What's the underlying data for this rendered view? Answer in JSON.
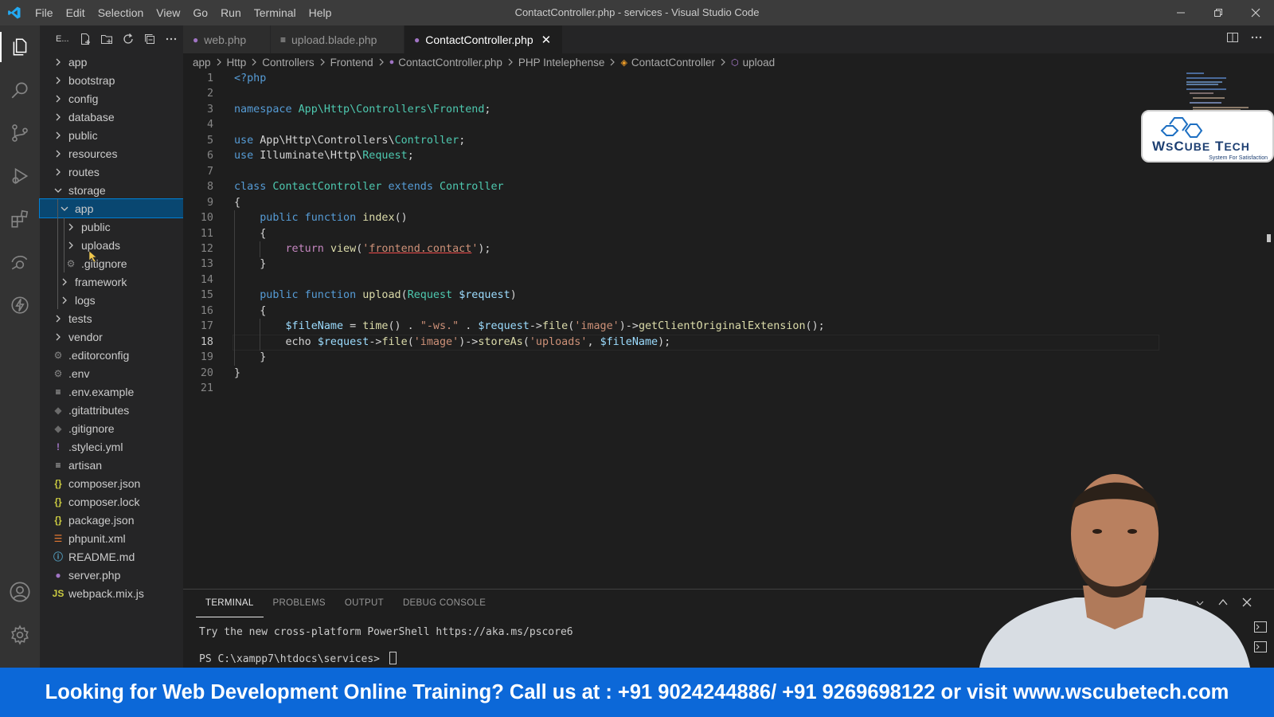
{
  "window": {
    "title": "ContactController.php - services - Visual Studio Code",
    "menu": [
      "File",
      "Edit",
      "Selection",
      "View",
      "Go",
      "Run",
      "Terminal",
      "Help"
    ]
  },
  "sidebar": {
    "title": "E...",
    "tree": [
      {
        "label": "app",
        "type": "folder",
        "expanded": false,
        "depth": 0
      },
      {
        "label": "bootstrap",
        "type": "folder",
        "expanded": false,
        "depth": 0
      },
      {
        "label": "config",
        "type": "folder",
        "expanded": false,
        "depth": 0
      },
      {
        "label": "database",
        "type": "folder",
        "expanded": false,
        "depth": 0
      },
      {
        "label": "public",
        "type": "folder",
        "expanded": false,
        "depth": 0
      },
      {
        "label": "resources",
        "type": "folder",
        "expanded": false,
        "depth": 0
      },
      {
        "label": "routes",
        "type": "folder",
        "expanded": false,
        "depth": 0
      },
      {
        "label": "storage",
        "type": "folder",
        "expanded": true,
        "depth": 0
      },
      {
        "label": "app",
        "type": "folder",
        "expanded": true,
        "depth": 1,
        "selected": true
      },
      {
        "label": "public",
        "type": "folder",
        "expanded": false,
        "depth": 2
      },
      {
        "label": "uploads",
        "type": "folder",
        "expanded": false,
        "depth": 2
      },
      {
        "label": ".gitignore",
        "type": "file",
        "icon": "gear-icon",
        "depth": 2
      },
      {
        "label": "framework",
        "type": "folder",
        "expanded": false,
        "depth": 1
      },
      {
        "label": "logs",
        "type": "folder",
        "expanded": false,
        "depth": 1
      },
      {
        "label": "tests",
        "type": "folder",
        "expanded": false,
        "depth": 0
      },
      {
        "label": "vendor",
        "type": "folder",
        "expanded": false,
        "depth": 0
      },
      {
        "label": ".editorconfig",
        "type": "file",
        "icon": "gear-icon",
        "depth": 0
      },
      {
        "label": ".env",
        "type": "file",
        "icon": "gear-icon",
        "depth": 0
      },
      {
        "label": ".env.example",
        "type": "file",
        "icon": "lines-icon",
        "depth": 0
      },
      {
        "label": ".gitattributes",
        "type": "file",
        "icon": "git-icon",
        "depth": 0
      },
      {
        "label": ".gitignore",
        "type": "file",
        "icon": "git-icon",
        "depth": 0
      },
      {
        "label": ".styleci.yml",
        "type": "file",
        "icon": "yaml-icon",
        "depth": 0
      },
      {
        "label": "artisan",
        "type": "file",
        "icon": "lines-icon",
        "depth": 0
      },
      {
        "label": "composer.json",
        "type": "file",
        "icon": "json-icon",
        "depth": 0
      },
      {
        "label": "composer.lock",
        "type": "file",
        "icon": "json-icon",
        "depth": 0
      },
      {
        "label": "package.json",
        "type": "file",
        "icon": "json-icon",
        "depth": 0
      },
      {
        "label": "phpunit.xml",
        "type": "file",
        "icon": "rss-icon",
        "depth": 0
      },
      {
        "label": "README.md",
        "type": "file",
        "icon": "info-icon",
        "depth": 0
      },
      {
        "label": "server.php",
        "type": "file",
        "icon": "php-icon",
        "depth": 0
      },
      {
        "label": "webpack.mix.js",
        "type": "file",
        "icon": "js-icon",
        "depth": 0
      }
    ]
  },
  "tabs": [
    {
      "label": "web.php",
      "icon": "php-icon",
      "active": false
    },
    {
      "label": "upload.blade.php",
      "icon": "lines-icon",
      "active": false
    },
    {
      "label": "ContactController.php",
      "icon": "php-icon",
      "active": true
    }
  ],
  "breadcrumb": [
    "app",
    "Http",
    "Controllers",
    "Frontend",
    "ContactController.php",
    "PHP Intelephense",
    "ContactController",
    "upload"
  ],
  "editor": {
    "current_line": 18,
    "lines": [
      {
        "n": "1",
        "tokens": [
          [
            "kw",
            "<?php"
          ]
        ]
      },
      {
        "n": "2",
        "tokens": []
      },
      {
        "n": "3",
        "tokens": [
          [
            "kw",
            "namespace "
          ],
          [
            "cls",
            "App\\Http\\Controllers\\Frontend"
          ],
          [
            "txt",
            ";"
          ]
        ]
      },
      {
        "n": "4",
        "tokens": []
      },
      {
        "n": "5",
        "tokens": [
          [
            "kw",
            "use "
          ],
          [
            "txt",
            "App\\Http\\Controllers\\"
          ],
          [
            "cls",
            "Controller"
          ],
          [
            "txt",
            ";"
          ]
        ]
      },
      {
        "n": "6",
        "tokens": [
          [
            "kw",
            "use "
          ],
          [
            "txt",
            "Illuminate\\Http\\"
          ],
          [
            "cls",
            "Request"
          ],
          [
            "txt",
            ";"
          ]
        ]
      },
      {
        "n": "7",
        "tokens": []
      },
      {
        "n": "8",
        "tokens": [
          [
            "kw",
            "class "
          ],
          [
            "cls",
            "ContactController "
          ],
          [
            "kw",
            "extends "
          ],
          [
            "cls",
            "Controller"
          ]
        ]
      },
      {
        "n": "9",
        "tokens": [
          [
            "txt",
            "{"
          ]
        ]
      },
      {
        "n": "10",
        "tokens": [
          [
            "txt",
            "    "
          ],
          [
            "kw",
            "public function "
          ],
          [
            "fn",
            "index"
          ],
          [
            "txt",
            "()"
          ]
        ]
      },
      {
        "n": "11",
        "tokens": [
          [
            "txt",
            "    {"
          ]
        ]
      },
      {
        "n": "12",
        "tokens": [
          [
            "txt",
            "        "
          ],
          [
            "ctrl",
            "return "
          ],
          [
            "fn",
            "view"
          ],
          [
            "txt",
            "("
          ],
          [
            "str",
            "'"
          ],
          [
            "strsq",
            "frontend.contact"
          ],
          [
            "str",
            "'"
          ],
          [
            "txt",
            ");"
          ]
        ]
      },
      {
        "n": "13",
        "tokens": [
          [
            "txt",
            "    }"
          ]
        ]
      },
      {
        "n": "14",
        "tokens": []
      },
      {
        "n": "15",
        "tokens": [
          [
            "txt",
            "    "
          ],
          [
            "kw",
            "public function "
          ],
          [
            "fn",
            "upload"
          ],
          [
            "txt",
            "("
          ],
          [
            "cls",
            "Request "
          ],
          [
            "var",
            "$request"
          ],
          [
            "txt",
            ")"
          ]
        ]
      },
      {
        "n": "16",
        "tokens": [
          [
            "txt",
            "    {"
          ]
        ]
      },
      {
        "n": "17",
        "tokens": [
          [
            "txt",
            "        "
          ],
          [
            "var",
            "$fileName "
          ],
          [
            "txt",
            "= "
          ],
          [
            "fn",
            "time"
          ],
          [
            "txt",
            "() . "
          ],
          [
            "str",
            "\"-ws.\""
          ],
          [
            "txt",
            " . "
          ],
          [
            "var",
            "$request"
          ],
          [
            "txt",
            "->"
          ],
          [
            "fn",
            "file"
          ],
          [
            "txt",
            "("
          ],
          [
            "str",
            "'image'"
          ],
          [
            "txt",
            ")->"
          ],
          [
            "fn",
            "getClientOriginalExtension"
          ],
          [
            "txt",
            "();"
          ]
        ]
      },
      {
        "n": "18",
        "tokens": [
          [
            "txt",
            "        "
          ],
          [
            "txt",
            "echo "
          ],
          [
            "var",
            "$request"
          ],
          [
            "txt",
            "->"
          ],
          [
            "fn",
            "file"
          ],
          [
            "txt",
            "("
          ],
          [
            "str",
            "'image'"
          ],
          [
            "txt",
            ")->"
          ],
          [
            "fn",
            "storeAs"
          ],
          [
            "txt",
            "("
          ],
          [
            "str",
            "'uploads'"
          ],
          [
            "txt",
            ", "
          ],
          [
            "var",
            "$fileName"
          ],
          [
            "txt",
            ");"
          ]
        ]
      },
      {
        "n": "19",
        "tokens": [
          [
            "txt",
            "    }"
          ]
        ]
      },
      {
        "n": "20",
        "tokens": [
          [
            "txt",
            "}"
          ]
        ]
      },
      {
        "n": "21",
        "tokens": []
      }
    ]
  },
  "brand": {
    "name": "WsCube Tech",
    "tagline": "System For Satisfaction",
    "color": "#1d3f72"
  },
  "panel": {
    "tabs": [
      "TERMINAL",
      "PROBLEMS",
      "OUTPUT",
      "DEBUG CONSOLE"
    ],
    "active_tab": "TERMINAL",
    "terminal_lines": [
      "Try the new cross-platform PowerShell https://aka.ms/pscore6",
      "PS C:\\xampp7\\htdocs\\services> "
    ]
  },
  "banner": {
    "text": "Looking for Web Development Online Training? Call us at : +91 9024244886/ +91 9269698122 or visit www.wscubetech.com",
    "color": "#0c68d8"
  },
  "colors": {
    "accent": "#007fd4",
    "selection": "#094771"
  }
}
